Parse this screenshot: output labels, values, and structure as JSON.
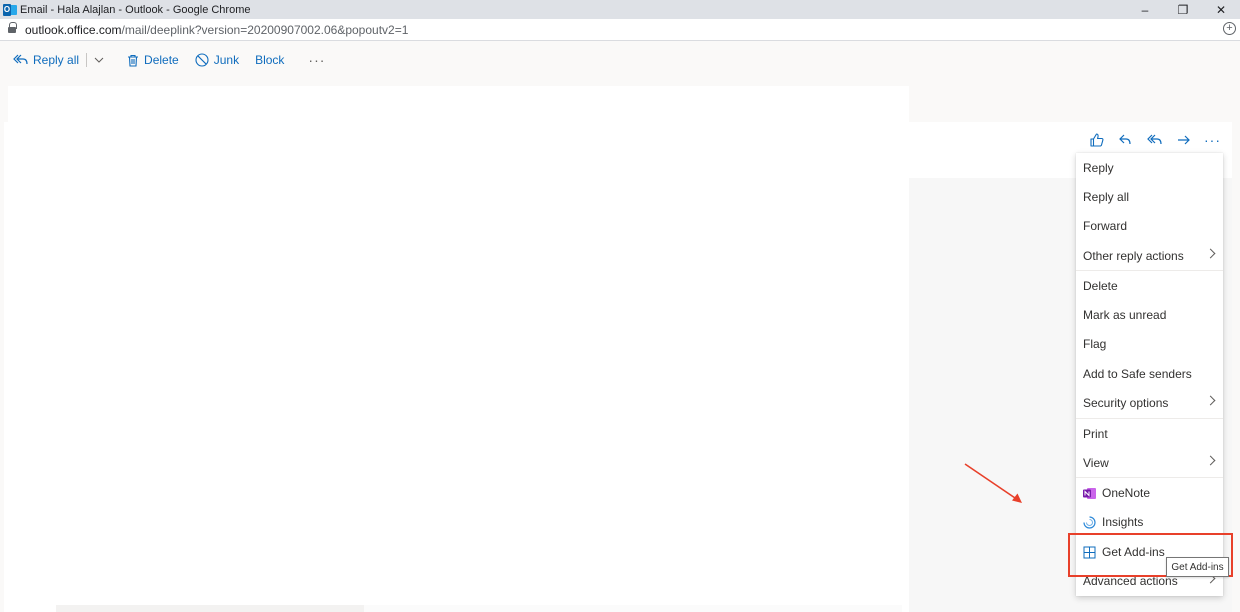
{
  "window": {
    "title": "Email - Hala Alajlan - Outlook - Google Chrome",
    "minimize": "–",
    "maximize": "❐",
    "close": "✕"
  },
  "address": {
    "domain": "outlook.office.com",
    "path": "/mail/deeplink?version=20200907002.06&popoutv2=1",
    "add_tab": "+"
  },
  "toolbar": {
    "reply_all": "Reply all",
    "delete": "Delete",
    "junk": "Junk",
    "block": "Block",
    "more": "···"
  },
  "message_actions": {
    "more": "···"
  },
  "menu": {
    "items": [
      {
        "label": "Reply"
      },
      {
        "label": "Reply all"
      },
      {
        "label": "Forward"
      },
      {
        "label": "Other reply actions"
      },
      {
        "label": "Delete"
      },
      {
        "label": "Mark as unread"
      },
      {
        "label": "Flag"
      },
      {
        "label": "Add to Safe senders"
      },
      {
        "label": "Security options"
      },
      {
        "label": "Print"
      },
      {
        "label": "View"
      },
      {
        "label": "OneNote"
      },
      {
        "label": "Insights"
      },
      {
        "label": "Get Add-ins"
      },
      {
        "label": "Advanced actions"
      }
    ]
  },
  "tooltip": {
    "text": "Get Add-ins"
  },
  "colors": {
    "accent": "#0f6cbd",
    "highlight": "#e8402a",
    "onenote": "#7719aa"
  }
}
